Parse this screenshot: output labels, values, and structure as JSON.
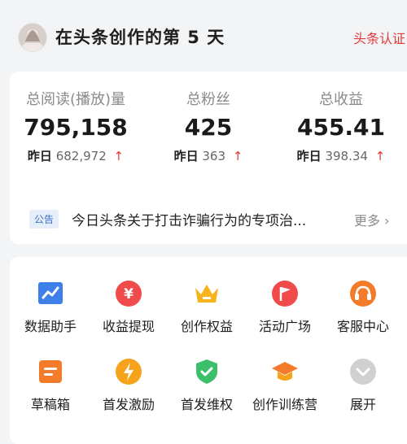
{
  "header": {
    "title": "在头条创作的第 5 天",
    "cert_link": "头条认证"
  },
  "stats": [
    {
      "label": "总阅读(播放)量",
      "value": "795,158",
      "yesterday_label": "昨日",
      "yesterday_value": "682,972",
      "trend": "↑"
    },
    {
      "label": "总粉丝",
      "value": "425",
      "yesterday_label": "昨日",
      "yesterday_value": "363",
      "trend": "↑"
    },
    {
      "label": "总收益",
      "value": "455.41",
      "yesterday_label": "昨日",
      "yesterday_value": "398.34",
      "trend": "↑"
    }
  ],
  "notice": {
    "tag": "公告",
    "text": "今日头条关于打击诈骗行为的专项治...",
    "more": "更多 ›"
  },
  "tools": [
    {
      "label": "数据助手",
      "icon": "chart-icon",
      "color": "#3f7fe9"
    },
    {
      "label": "收益提现",
      "icon": "yuan-icon",
      "color": "#f04a4a"
    },
    {
      "label": "创作权益",
      "icon": "crown-icon",
      "color": "#f6b31b"
    },
    {
      "label": "活动广场",
      "icon": "flag-icon",
      "color": "#f04a4a"
    },
    {
      "label": "客服中心",
      "icon": "headset-icon",
      "color": "#f47b2a"
    },
    {
      "label": "草稿箱",
      "icon": "draft-icon",
      "color": "#f47b2a"
    },
    {
      "label": "首发激励",
      "icon": "lightning-icon",
      "color": "#f6a21b"
    },
    {
      "label": "首发维权",
      "icon": "shield-icon",
      "color": "#3cbf6b"
    },
    {
      "label": "创作训练营",
      "icon": "graduation-cap-icon",
      "color": "#f47b2a"
    },
    {
      "label": "展开",
      "icon": "expand-icon",
      "color": "#c8c8c8"
    }
  ]
}
